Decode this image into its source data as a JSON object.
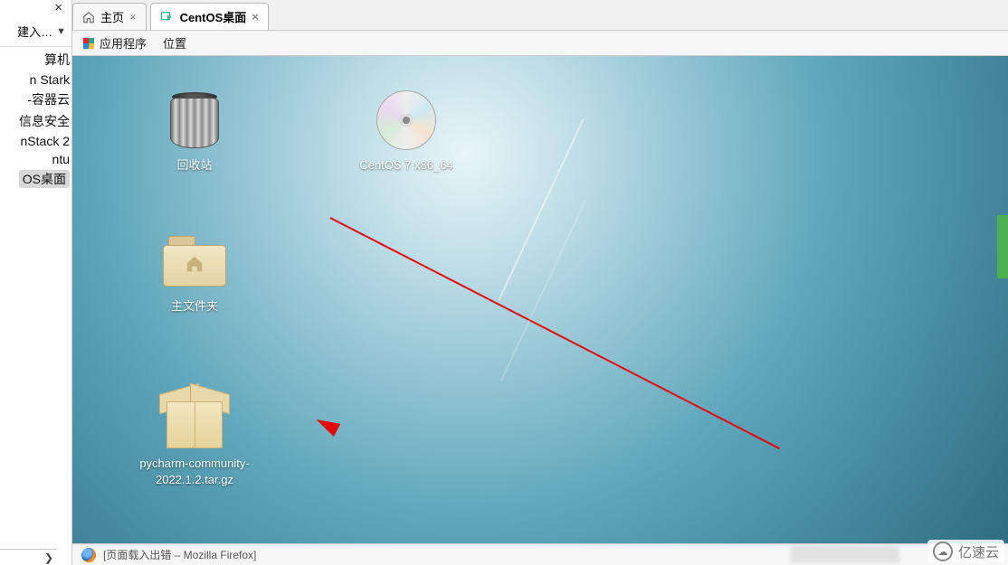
{
  "tabs": [
    {
      "label": "主页",
      "active": false
    },
    {
      "label": "CentOS桌面",
      "active": true
    }
  ],
  "sidebar": {
    "quick_input": "建入…",
    "items": [
      "算机",
      "n Stark",
      "-容器云",
      "信息安全",
      "nStack 2",
      "ntu",
      "OS桌面"
    ],
    "selected_index": 6
  },
  "guest_menus": {
    "applications": "应用程序",
    "location": "位置"
  },
  "desktop_icons": {
    "trash": "回收站",
    "disc": "CentOS 7 x86_64",
    "home": "主文件夹",
    "archive": "pycharm-community-2022.1.2.tar.gz"
  },
  "taskbar": {
    "firefox_title": "[页面载入出错 – Mozilla Firefox]"
  },
  "watermark": "亿速云",
  "colors": {
    "arrow": "#e60000",
    "side_tab": "#4caf50"
  }
}
